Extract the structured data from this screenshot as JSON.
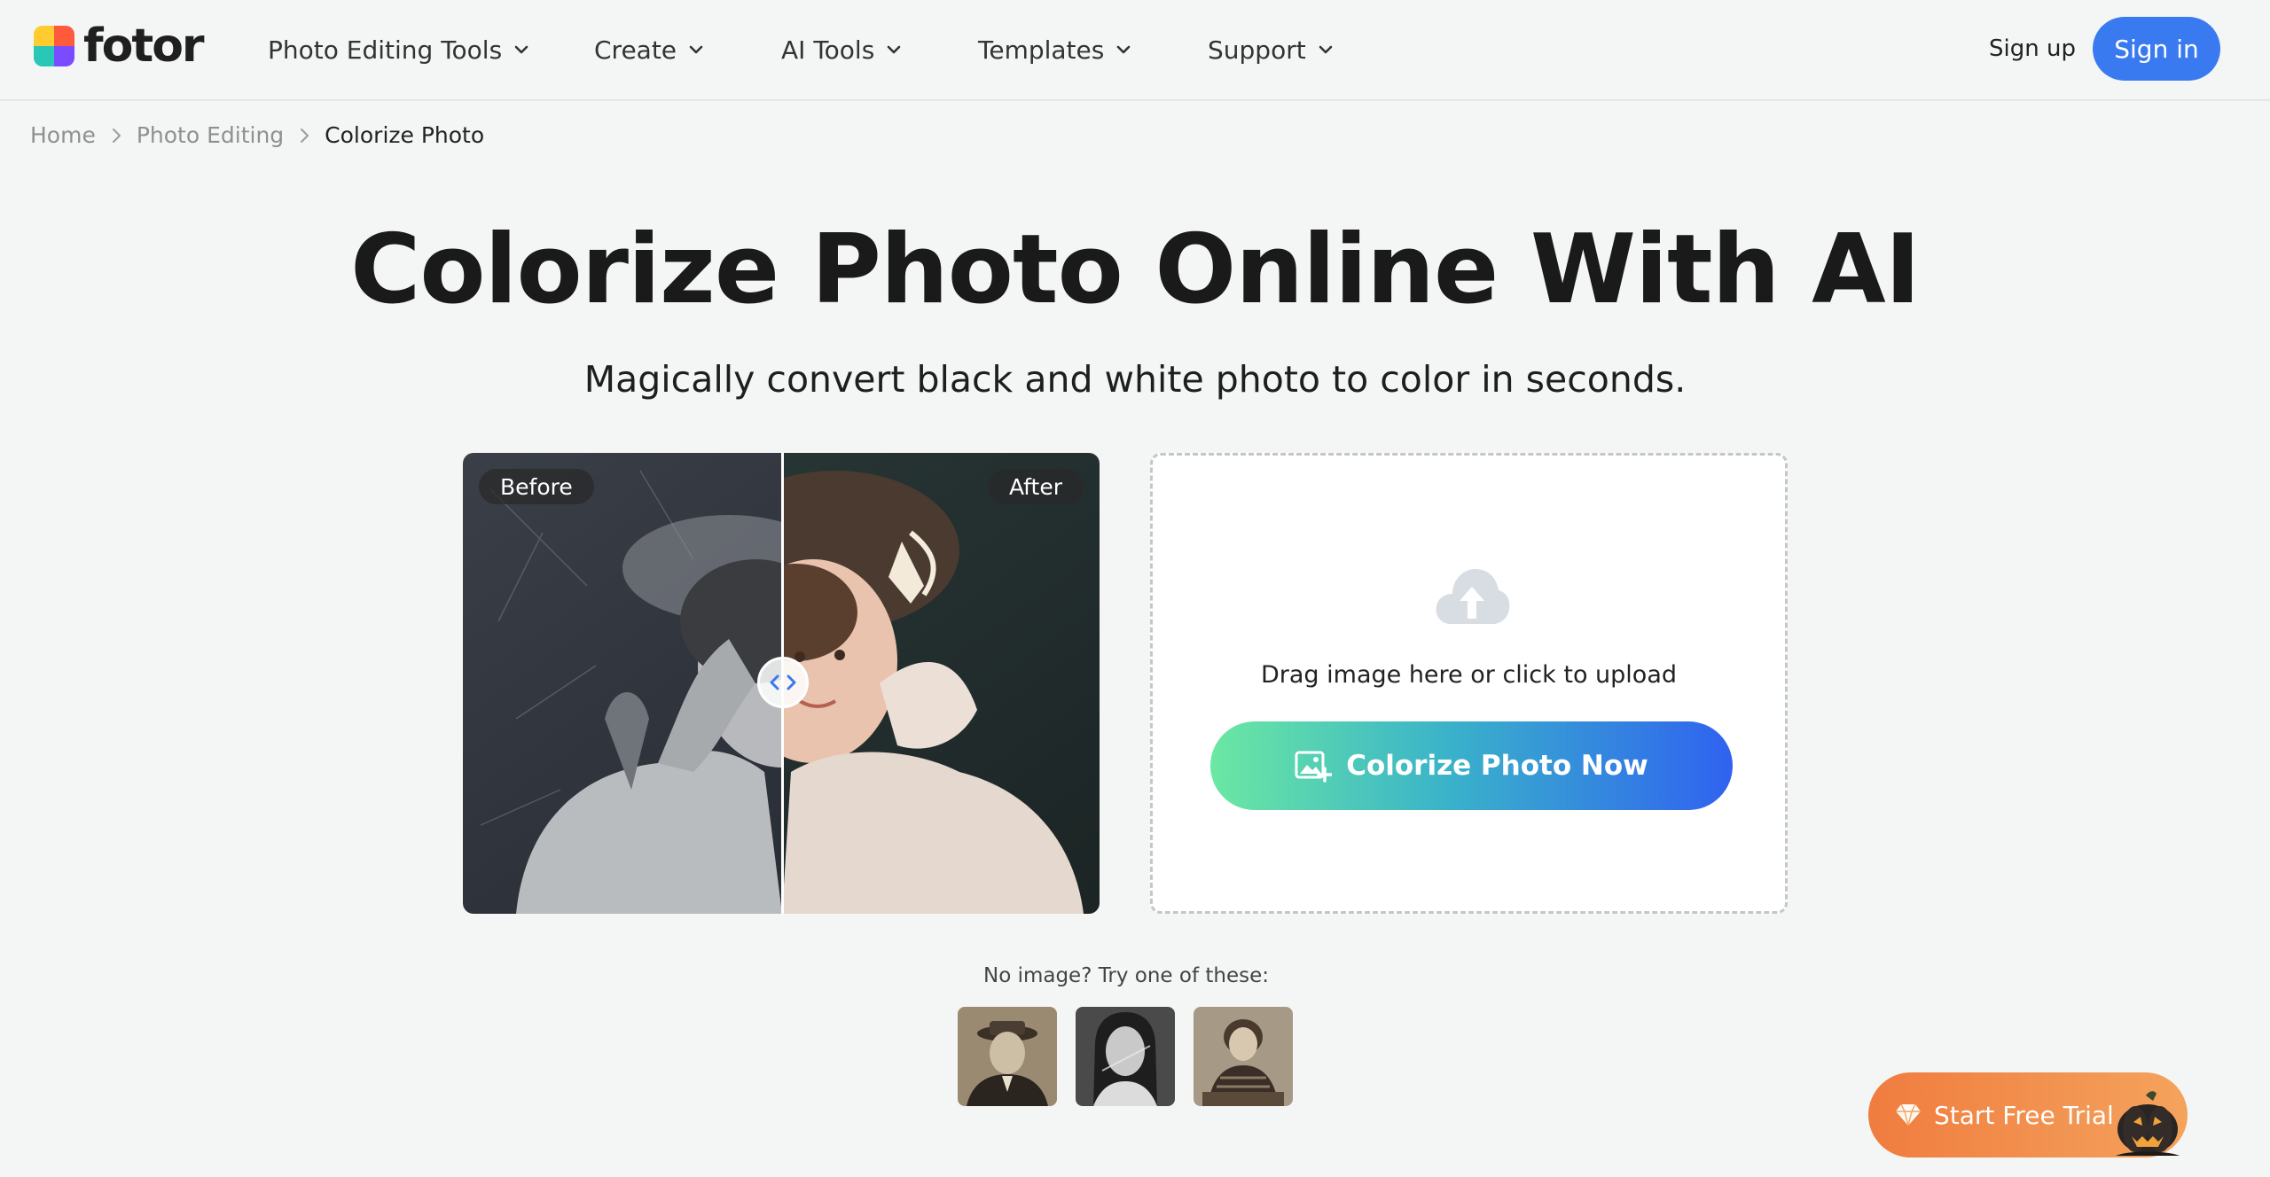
{
  "header": {
    "logo_text": "fotor",
    "nav": [
      {
        "label": "Photo Editing Tools"
      },
      {
        "label": "Create"
      },
      {
        "label": "AI Tools"
      },
      {
        "label": "Templates"
      },
      {
        "label": "Support"
      }
    ],
    "signup_label": "Sign up",
    "signin_label": "Sign in"
  },
  "breadcrumb": {
    "items": [
      "Home",
      "Photo Editing",
      "Colorize Photo"
    ]
  },
  "hero": {
    "title": "Colorize Photo Online With AI",
    "subtitle": "Magically convert black and white photo to color in seconds."
  },
  "compare": {
    "before_label": "Before",
    "after_label": "After"
  },
  "upload": {
    "drop_text": "Drag image here or click to upload",
    "cta_label": "Colorize Photo Now"
  },
  "samples": {
    "label": "No image? Try one of these:"
  },
  "trial": {
    "label": "Start Free Trial"
  },
  "colors": {
    "accent": "#3a7af0",
    "cta_start": "#6be8a2",
    "cta_end": "#2f62f0",
    "trial": "#f07c3f"
  }
}
